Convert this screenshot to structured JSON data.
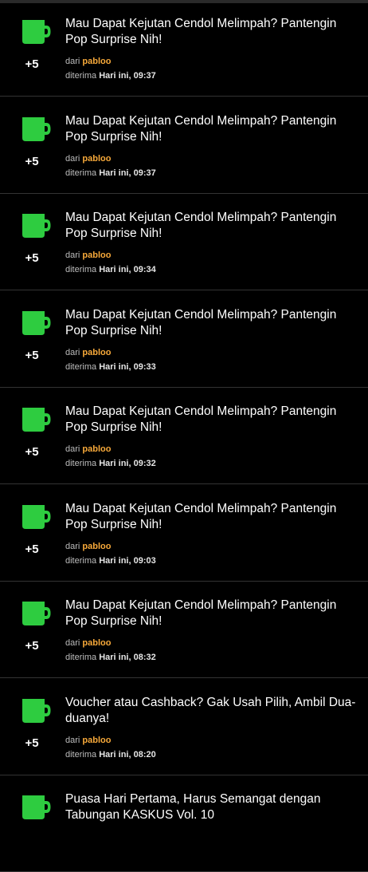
{
  "colors": {
    "background": "#000000",
    "mug_icon": "#2ecc40",
    "author": "#f7a93a",
    "divider": "#333333"
  },
  "icon": "mug-icon",
  "notifications": [
    {
      "points": "+5",
      "title": "Mau Dapat Kejutan Cendol Melimpah? Pantengin Pop Surprise Nih!",
      "from_label": "dari",
      "author": "pabloo",
      "received_label": "diterima",
      "time": "Hari ini, 09:37"
    },
    {
      "points": "+5",
      "title": "Mau Dapat Kejutan Cendol Melimpah? Pantengin Pop Surprise Nih!",
      "from_label": "dari",
      "author": "pabloo",
      "received_label": "diterima",
      "time": "Hari ini, 09:37"
    },
    {
      "points": "+5",
      "title": "Mau Dapat Kejutan Cendol Melimpah? Pantengin Pop Surprise Nih!",
      "from_label": "dari",
      "author": "pabloo",
      "received_label": "diterima",
      "time": "Hari ini, 09:34"
    },
    {
      "points": "+5",
      "title": "Mau Dapat Kejutan Cendol Melimpah? Pantengin Pop Surprise Nih!",
      "from_label": "dari",
      "author": "pabloo",
      "received_label": "diterima",
      "time": "Hari ini, 09:33"
    },
    {
      "points": "+5",
      "title": "Mau Dapat Kejutan Cendol Melimpah? Pantengin Pop Surprise Nih!",
      "from_label": "dari",
      "author": "pabloo",
      "received_label": "diterima",
      "time": "Hari ini, 09:32"
    },
    {
      "points": "+5",
      "title": "Mau Dapat Kejutan Cendol Melimpah? Pantengin Pop Surprise Nih!",
      "from_label": "dari",
      "author": "pabloo",
      "received_label": "diterima",
      "time": "Hari ini, 09:03"
    },
    {
      "points": "+5",
      "title": "Mau Dapat Kejutan Cendol Melimpah? Pantengin Pop Surprise Nih!",
      "from_label": "dari",
      "author": "pabloo",
      "received_label": "diterima",
      "time": "Hari ini, 08:32"
    },
    {
      "points": "+5",
      "title": "Voucher atau Cashback? Gak Usah Pilih, Ambil Dua-duanya!",
      "from_label": "dari",
      "author": "pabloo",
      "received_label": "diterima",
      "time": "Hari ini, 08:20"
    },
    {
      "points": "",
      "title": "Puasa Hari Pertama, Harus Semangat dengan Tabungan KASKUS Vol. 10",
      "from_label": "",
      "author": "",
      "received_label": "",
      "time": ""
    }
  ]
}
